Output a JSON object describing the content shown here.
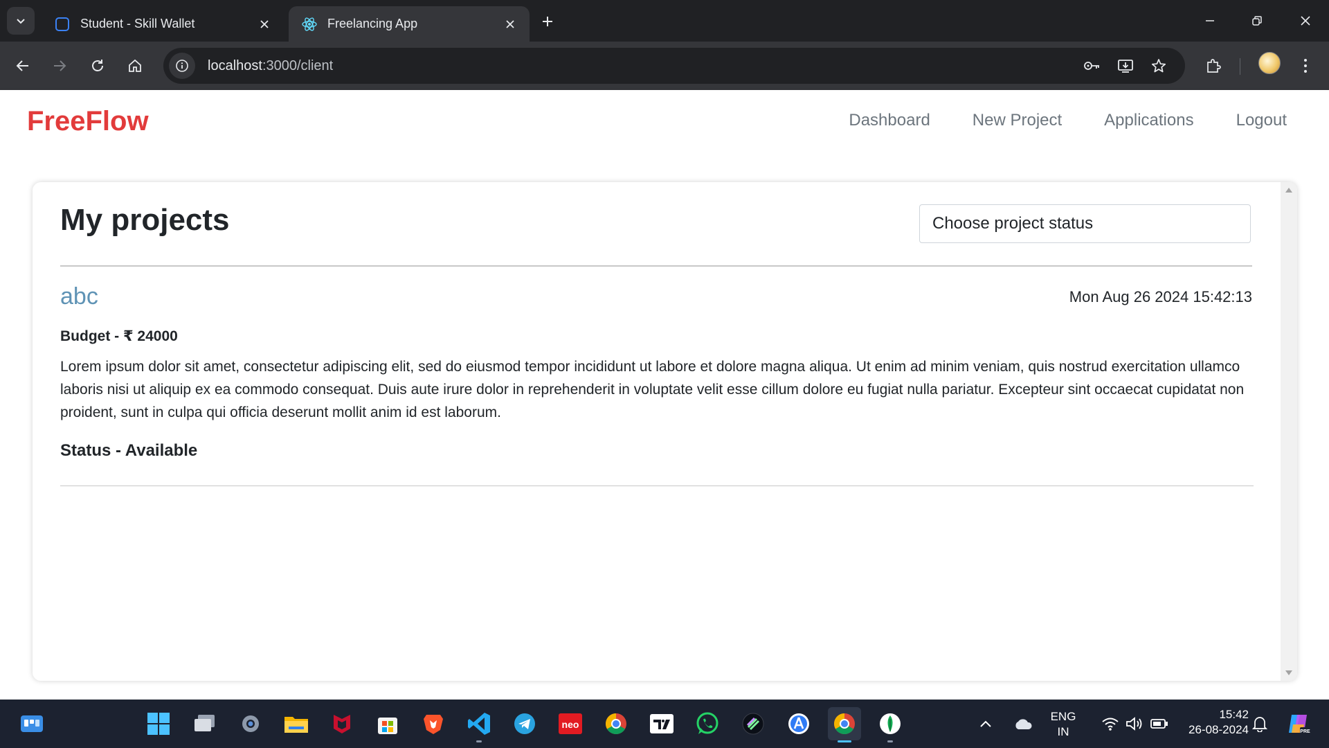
{
  "browser": {
    "tabs": [
      {
        "title": "Student - Skill Wallet",
        "active": false
      },
      {
        "title": "Freelancing App",
        "active": true
      }
    ],
    "url_host": "localhost",
    "url_path": ":3000/client"
  },
  "app": {
    "brand": "FreeFlow",
    "nav": [
      "Dashboard",
      "New Project",
      "Applications",
      "Logout"
    ]
  },
  "page": {
    "title": "My projects",
    "status_select_placeholder": "Choose project status"
  },
  "project": {
    "name": "abc",
    "date": "Mon Aug 26 2024 15:42:13",
    "budget": "Budget - ₹ 24000",
    "description": "Lorem ipsum dolor sit amet, consectetur adipiscing elit, sed do eiusmod tempor incididunt ut labore et dolore magna aliqua. Ut enim ad minim veniam, quis nostrud exercitation ullamco laboris nisi ut aliquip ex ea commodo consequat. Duis aute irure dolor in reprehenderit in voluptate velit esse cillum dolore eu fugiat nulla pariatur. Excepteur sint occaecat cupidatat non proident, sunt in culpa qui officia deserunt mollit anim id est laborum.",
    "status": "Status - Available"
  },
  "taskbar": {
    "lang_line1": "ENG",
    "lang_line2": "IN",
    "time": "15:42",
    "date": "26-08-2024",
    "pinned": [
      "windows-start-icon",
      "task-view-icon",
      "settings-icon",
      "file-explorer-icon",
      "mcafee-icon",
      "microsoft-store-icon",
      "brave-icon",
      "vscode-icon",
      "telegram-icon",
      "neo-icon",
      "chrome-icon",
      "tradingview-icon",
      "whatsapp-icon",
      "linear-icon",
      "app-store-icon",
      "chrome-active-icon",
      "mongodb-compass-icon"
    ]
  },
  "colors": {
    "brand": "#e23b3b",
    "project_name": "#5f93b5",
    "nav_link": "#6c757d",
    "chrome_dark": "#202124",
    "chrome_toolbar": "#35363a",
    "taskbar": "#1c2230"
  }
}
